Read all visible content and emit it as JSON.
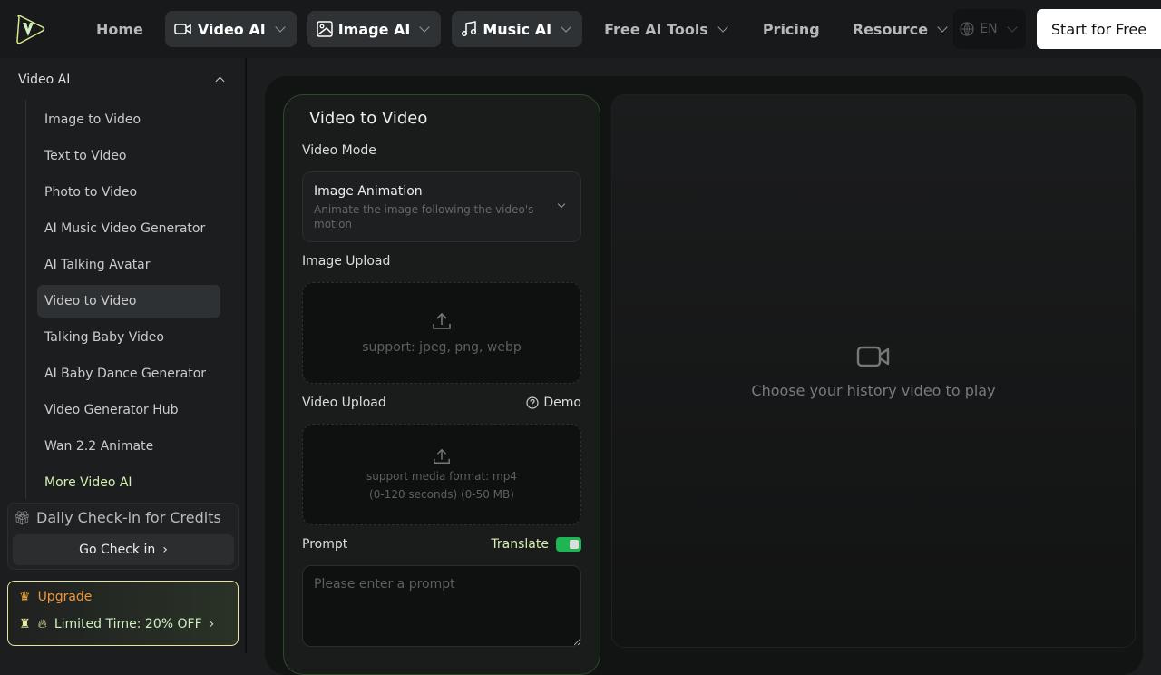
{
  "header": {
    "nav": [
      {
        "label": "Home"
      },
      {
        "label": "Video AI",
        "icon": "video-icon"
      },
      {
        "label": "Image AI",
        "icon": "image-icon"
      },
      {
        "label": "Music AI",
        "icon": "music-icon"
      },
      {
        "label": "Free AI Tools"
      },
      {
        "label": "Pricing"
      },
      {
        "label": "Resource"
      }
    ],
    "lang": "EN",
    "start": "Start for Free"
  },
  "sidebar": {
    "section": "Video AI",
    "items": [
      "Image to Video",
      "Text to Video",
      "Photo to Video",
      "AI Music Video Generator",
      "AI Talking Avatar",
      "Video to Video",
      "Talking Baby Video",
      "AI Baby Dance Generator",
      "Video Generator Hub",
      "Wan 2.2 Animate",
      "More Video AI"
    ],
    "active": "Video to Video",
    "checkin_title": "Daily Check-in for Credits",
    "checkin_button": "Go Check in",
    "upgrade": "Upgrade",
    "offer": "Limited Time: 20% OFF"
  },
  "panel": {
    "title": "Video to Video",
    "mode_label": "Video Mode",
    "mode_value": "Image Animation",
    "mode_desc": "Animate the image following the video's motion",
    "image_label": "Image Upload",
    "image_hint": "support: jpeg, png, webp",
    "video_label": "Video Upload",
    "demo": "Demo",
    "video_hint1": "support media format: mp4",
    "video_hint2": "(0-120 seconds) (0-50 MB)",
    "prompt_label": "Prompt",
    "translate": "Translate",
    "translate_on": true,
    "prompt_placeholder": "Please enter a prompt"
  },
  "player": {
    "text": "Choose your history video to play"
  }
}
